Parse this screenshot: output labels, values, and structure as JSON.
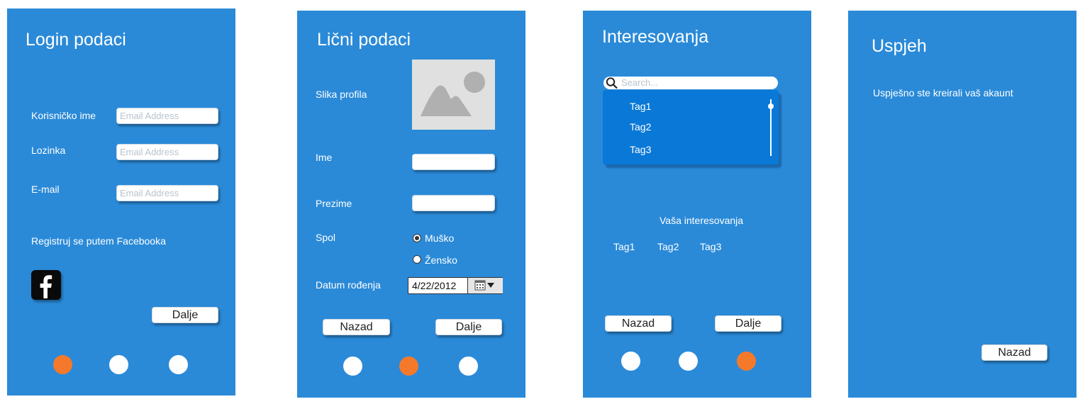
{
  "screen1": {
    "title": "Login podaci",
    "username_label": "Korisničko ime",
    "username_placeholder": "Email Address",
    "password_label": "Lozinka",
    "password_placeholder": "Email Address",
    "email_label": "E-mail",
    "email_placeholder": "Email Address",
    "facebook_text": "Registruj se putem Facebooka",
    "next_label": "Dalje",
    "active_step": 1
  },
  "screen2": {
    "title": "Lični podaci",
    "photo_label": "Slika profila",
    "first_name_label": "Ime",
    "last_name_label": "Prezime",
    "gender_label": "Spol",
    "gender_options": [
      "Muško",
      "Žensko"
    ],
    "gender_selected": "Muško",
    "birthdate_label": "Datum rođenja",
    "birthdate_value": "4/22/2012",
    "back_label": "Nazad",
    "next_label": "Dalje",
    "active_step": 2
  },
  "screen3": {
    "title": "Interesovanja",
    "search_placeholder": "Search...",
    "list_tags": [
      "Tag1",
      "Tag2",
      "Tag3"
    ],
    "selected_heading": "Vaša interesovanja",
    "selected_tags": [
      "Tag1",
      "Tag2",
      "Tag3"
    ],
    "back_label": "Nazad",
    "next_label": "Dalje",
    "active_step": 3
  },
  "screen4": {
    "title": "Uspjeh",
    "message": "Uspješno ste kreirali vaš akaunt",
    "back_label": "Nazad"
  },
  "colors": {
    "panel": "#2a8ad8",
    "list": "#0a78d7",
    "active_dot": "#f5792a",
    "inactive_dot": "#ffffff"
  }
}
